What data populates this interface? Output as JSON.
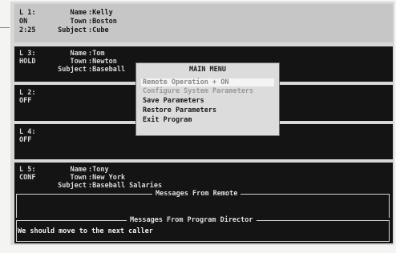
{
  "lines": [
    {
      "id": "L1",
      "label": "L 1:",
      "status": "ON",
      "time": "2:25",
      "fields": [
        {
          "k": "Name",
          "v": ":Kelly"
        },
        {
          "k": "Town",
          "v": ":Boston"
        },
        {
          "k": "Subject",
          "v": ":Cube"
        }
      ]
    },
    {
      "id": "L3",
      "label": "L 3:",
      "status": "HOLD",
      "fields": [
        {
          "k": "Name",
          "v": ":Tom"
        },
        {
          "k": "Town",
          "v": ":Newton"
        },
        {
          "k": "Subject",
          "v": ":Baseball"
        }
      ]
    },
    {
      "id": "L2",
      "label": "L 2:",
      "status": "OFF"
    },
    {
      "id": "L4",
      "label": "L 4:",
      "status": "OFF"
    },
    {
      "id": "L5",
      "label": "L 5:",
      "status": "CONF",
      "fields": [
        {
          "k": "Name",
          "v": ":Tony"
        },
        {
          "k": "Town",
          "v": ":New York"
        },
        {
          "k": "Subject",
          "v": ":Baseball Salaries"
        }
      ]
    }
  ],
  "menu": {
    "title": "MAIN MENU",
    "items": [
      {
        "label": "Remote Operation + ON",
        "state": "selected"
      },
      {
        "label": "Configure System Parameters",
        "state": "disabled"
      },
      {
        "label": "Save Parameters",
        "state": "normal"
      },
      {
        "label": "Restore Parameters",
        "state": "normal"
      },
      {
        "label": "Exit Program",
        "state": "normal"
      }
    ]
  },
  "messages_remote": {
    "title": "Messages From Remote",
    "text": ""
  },
  "messages_director": {
    "title": "Messages From Program Director",
    "text": "We should move to the next caller"
  }
}
